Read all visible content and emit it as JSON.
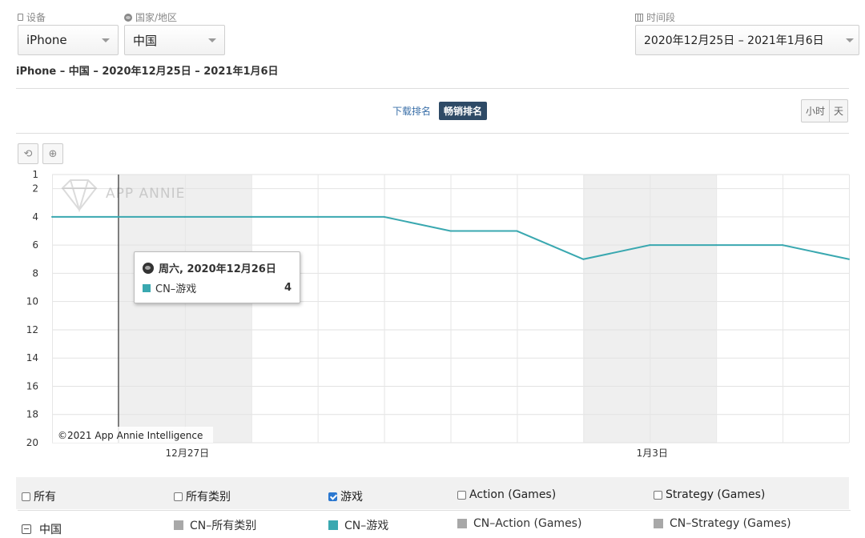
{
  "filters": {
    "device_label": "设备",
    "device_value": "iPhone",
    "country_label": "国家/地区",
    "country_value": "中国",
    "period_label": "时间段",
    "period_value": "2020年12月25日 – 2021年1月6日"
  },
  "subtitle": "iPhone – 中国 – 2020年12月25日 – 2021年1月6日",
  "rank_toggle": {
    "download": "下载排名",
    "grossing": "畅销排名",
    "active": "grossing"
  },
  "granularity": {
    "hour": "小时",
    "day": "天"
  },
  "toolbar": {
    "reset_icon": "reset-icon",
    "zoom_icon": "zoom-icon"
  },
  "colors": {
    "series": "#3aa8b0",
    "gray_series": "#a8a8a8",
    "active_toggle": "#2e4a66"
  },
  "chart_data": {
    "type": "line",
    "x": [
      "2020-12-25",
      "2020-12-26",
      "2020-12-27",
      "2020-12-28",
      "2020-12-29",
      "2020-12-30",
      "2020-12-31",
      "2021-01-01",
      "2021-01-02",
      "2021-01-03",
      "2021-01-04",
      "2021-01-05",
      "2021-01-06"
    ],
    "series": [
      {
        "name": "CN–游戏",
        "values": [
          4,
          4,
          4,
          4,
          4,
          4,
          5,
          5,
          7,
          6,
          6,
          6,
          7
        ]
      }
    ],
    "y_ticks": [
      1,
      2,
      4,
      6,
      8,
      10,
      12,
      14,
      16,
      18,
      20
    ],
    "ylim": [
      1,
      20
    ],
    "y_inverted": true,
    "x_tick_labels": [
      {
        "x": "2020-12-27",
        "label": "12月27日"
      },
      {
        "x": "2021-01-03",
        "label": "1月3日"
      }
    ],
    "weekend_shading": [
      [
        "2020-12-26",
        "2020-12-28"
      ],
      [
        "2021-01-02",
        "2021-01-04"
      ]
    ],
    "crosshair_x": "2020-12-26",
    "watermark": "APP ANNIE",
    "credit": "©2021 App Annie Intelligence",
    "grid": true
  },
  "tooltip": {
    "date": "周六, 2020年12月26日",
    "series": "CN–游戏",
    "value": "4"
  },
  "legend": {
    "checkboxes": [
      {
        "label": "所有",
        "checked": false
      },
      {
        "label": "所有类别",
        "checked": false
      },
      {
        "label": "游戏",
        "checked": true
      },
      {
        "label": "Action (Games)",
        "checked": false
      },
      {
        "label": "Strategy (Games)",
        "checked": false
      }
    ],
    "region": "中国",
    "series": [
      {
        "label": "CN–所有类别",
        "color": "#a8a8a8"
      },
      {
        "label": "CN–游戏",
        "color": "#3aa8b0"
      },
      {
        "label": "CN–Action (Games)",
        "color": "#a8a8a8"
      },
      {
        "label": "CN–Strategy (Games)",
        "color": "#a8a8a8"
      }
    ]
  }
}
